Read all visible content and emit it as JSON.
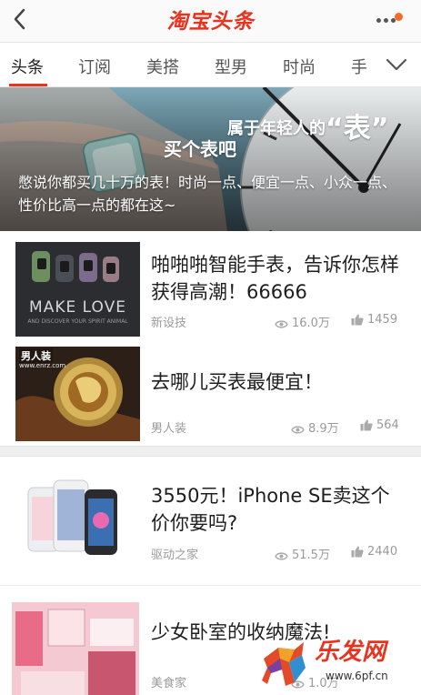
{
  "app": {
    "logo_text": "淘宝头条",
    "brand_color": "#e8341f"
  },
  "top_bar": {
    "back_icon": "chevron-left-icon",
    "more_icon": "more-dots-icon",
    "notify_color": "#f26b2a"
  },
  "tabs": {
    "items": [
      {
        "label": "头条",
        "active": true
      },
      {
        "label": "订阅",
        "active": false
      },
      {
        "label": "美搭",
        "active": false
      },
      {
        "label": "型男",
        "active": false
      },
      {
        "label": "时尚",
        "active": false
      },
      {
        "label": "手",
        "active": false
      }
    ],
    "expand_icon": "chevron-down-icon"
  },
  "hero": {
    "headline_prefix": "属于年轻人的",
    "headline_big": "“表”",
    "subline": "买个表吧",
    "description": "憋说你都买几十万的表！时尚一点、便宜一点、小众一点、性价比高一点的都在这~"
  },
  "articles": [
    {
      "title": "啪啪啪智能手表，告诉你怎样获得高潮！66666",
      "source": "新设技",
      "views": "16.0万",
      "likes": "1459",
      "thumb_text": "MAKE LOVE",
      "thumb_subtext": "AND DISCOVER YOUR SPIRIT ANIMAL"
    },
    {
      "title": "去哪儿买表最便宜！",
      "source": "男人装",
      "views": "8.9万",
      "likes": "564",
      "thumb_text": "男人装",
      "thumb_subtext": "www.enrz.com"
    },
    {
      "title": "3550元！iPhone SE卖这个价你要吗?",
      "source": "驱动之家",
      "views": "51.5万",
      "likes": "2440"
    },
    {
      "title": "少女卧室的收纳魔法!",
      "source": "美食家",
      "views": "1.0万",
      "likes": ""
    }
  ],
  "watermark": {
    "text": "乐发网",
    "url": "www.6pf.cn"
  }
}
